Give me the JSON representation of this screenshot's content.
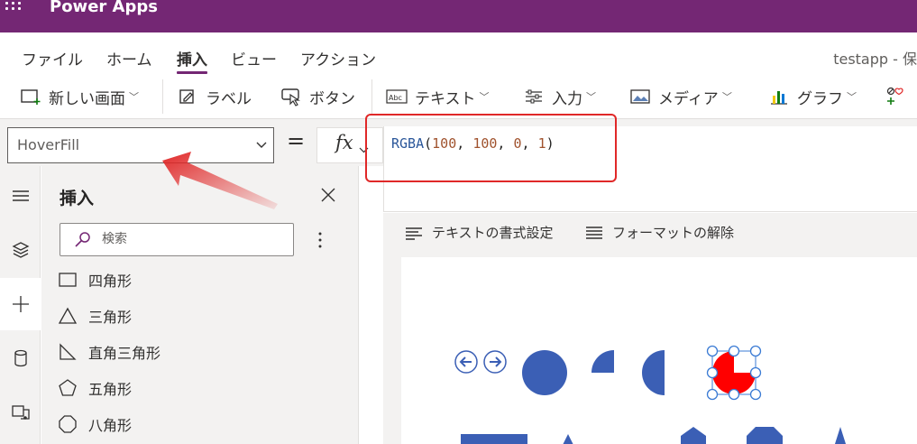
{
  "app": {
    "title": "Power Apps",
    "document_title": "testapp - 保"
  },
  "menu": {
    "tabs": [
      {
        "label": "ファイル",
        "active": false
      },
      {
        "label": "ホーム",
        "active": false
      },
      {
        "label": "挿入",
        "active": true
      },
      {
        "label": "ビュー",
        "active": false
      },
      {
        "label": "アクション",
        "active": false
      }
    ]
  },
  "ribbon": {
    "new_screen": "新しい画面",
    "label": "ラベル",
    "button": "ボタン",
    "text": "テキスト",
    "input": "入力",
    "media": "メディア",
    "chart": "グラフ"
  },
  "formula": {
    "property": "HoverFill",
    "equals": "=",
    "fx": "fx",
    "tokens": {
      "fn": "RGBA",
      "open": "(",
      "r": "100",
      "c1": ", ",
      "g": "100",
      "c2": ", ",
      "b": "0",
      "c3": ", ",
      "a": "1",
      "close": ")"
    }
  },
  "pane": {
    "title": "挿入",
    "search_placeholder": "検索",
    "items": [
      "四角形",
      "三角形",
      "直角三角形",
      "五角形",
      "八角形"
    ]
  },
  "canvas_toolbar": {
    "text_format": "テキストの書式設定",
    "clear_format": "フォーマットの解除"
  },
  "colors": {
    "brand": "#742774",
    "shape_fill": "#3b5fb5",
    "selected_fill": "#ff0000",
    "annotation": "#e02828",
    "handle": "#3b7bd4"
  },
  "icons": {
    "waffle": "waffle-icon",
    "close": "close-icon",
    "search": "search-icon",
    "more": "more-vertical-icon"
  }
}
